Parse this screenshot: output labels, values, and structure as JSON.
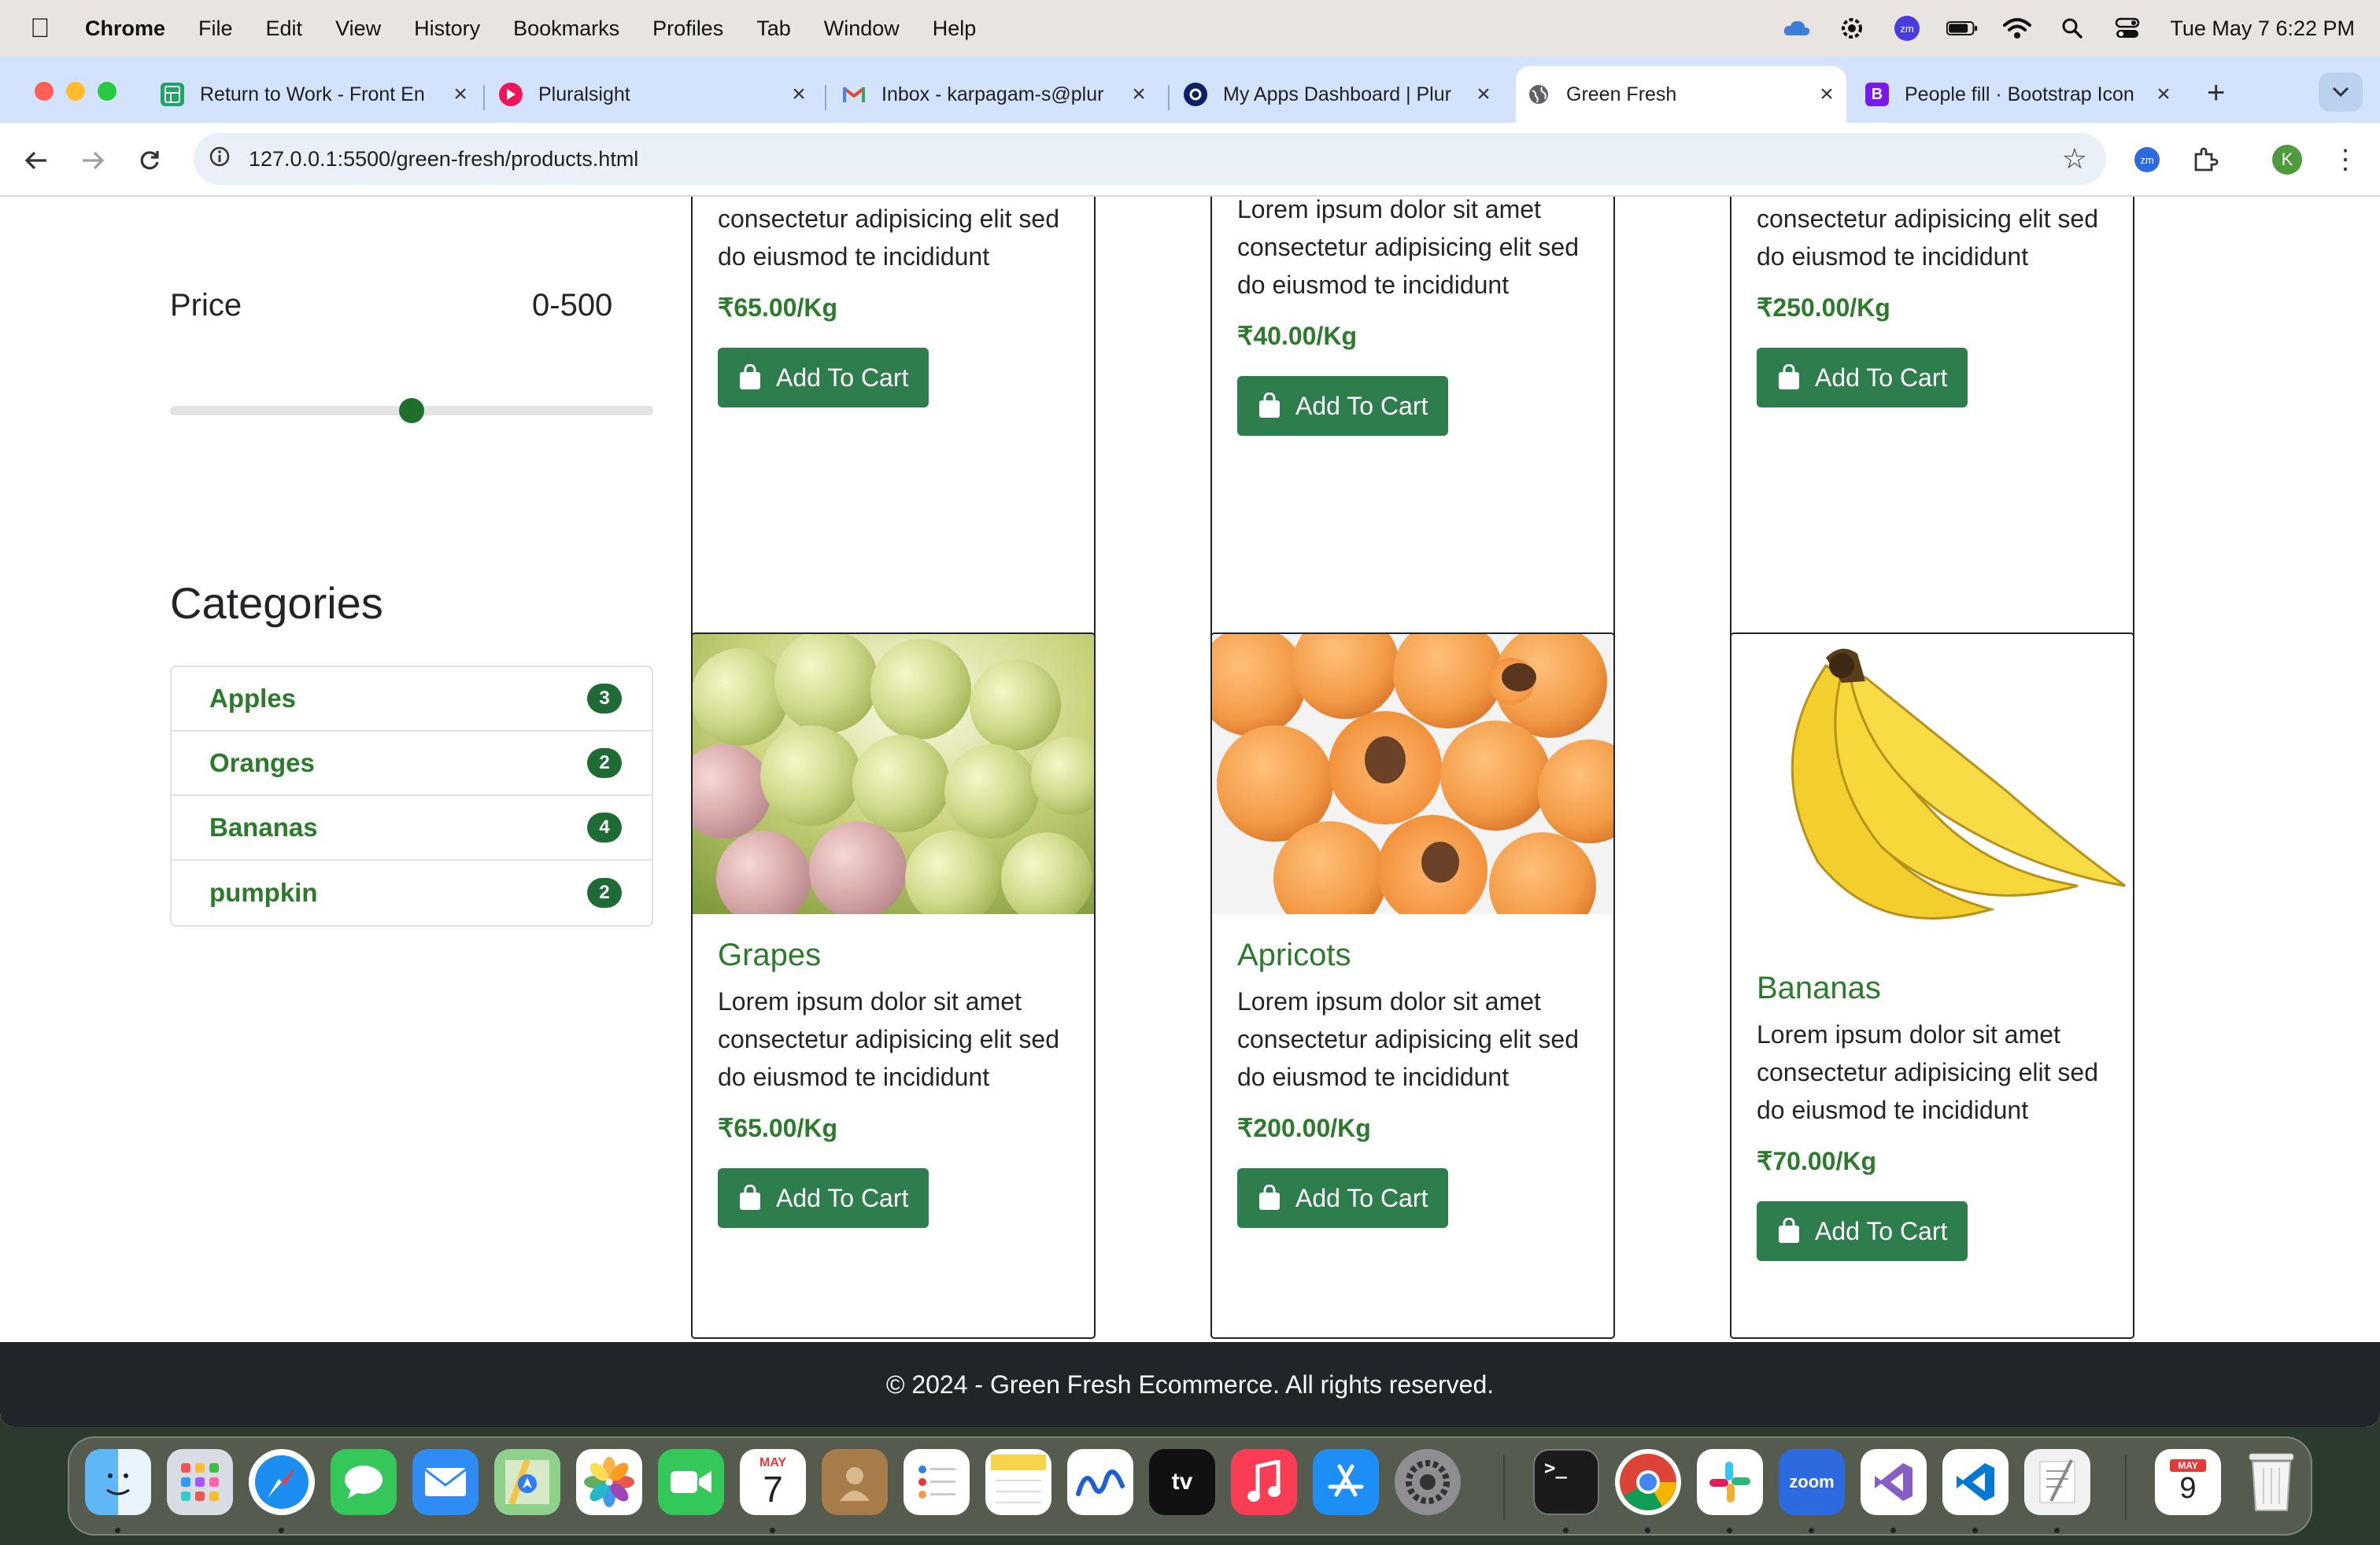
{
  "menubar": {
    "app": "Chrome",
    "items": [
      "File",
      "Edit",
      "View",
      "History",
      "Bookmarks",
      "Profiles",
      "Tab",
      "Window",
      "Help"
    ],
    "clock": "Tue May 7  6:22 PM"
  },
  "tabs": [
    {
      "title": "Return to Work - Front En",
      "icon": "sheets-icon"
    },
    {
      "title": "Pluralsight",
      "icon": "pluralsight-icon"
    },
    {
      "title": "Inbox - karpagam-s@plur",
      "icon": "gmail-icon"
    },
    {
      "title": "My Apps Dashboard | Plur",
      "icon": "okta-icon"
    },
    {
      "title": "Green Fresh",
      "icon": "globe-icon"
    },
    {
      "title": "People fill · Bootstrap Icon",
      "icon": "bootstrap-icon"
    }
  ],
  "toolbar": {
    "url": "127.0.0.1:5500/green-fresh/products.html",
    "profile_initial": "K"
  },
  "sidebar": {
    "price_label": "Price",
    "price_range": "0-500",
    "price_slider_value": 250,
    "price_slider_max": 500,
    "categories_title": "Categories",
    "categories": [
      {
        "name": "Apples",
        "count": "3"
      },
      {
        "name": "Oranges",
        "count": "2"
      },
      {
        "name": "Bananas",
        "count": "4"
      },
      {
        "name": "pumpkin",
        "count": "2"
      }
    ]
  },
  "products_top": [
    {
      "text": "consectetur adipisicing elit sed do eiusmod te incididunt",
      "price": "₹65.00/Kg",
      "button": "Add To Cart"
    },
    {
      "text": "Lorem ipsum dolor sit amet consectetur adipisicing elit sed do eiusmod te incididunt",
      "price": "₹40.00/Kg",
      "button": "Add To Cart"
    },
    {
      "text": "consectetur adipisicing elit sed do eiusmod te incididunt",
      "price": "₹250.00/Kg",
      "button": "Add To Cart"
    }
  ],
  "products": [
    {
      "name": "Grapes",
      "text": "Lorem ipsum dolor sit amet consectetur adipisicing elit sed do eiusmod te incididunt",
      "price": "₹65.00/Kg",
      "button": "Add To Cart"
    },
    {
      "name": "Apricots",
      "text": "Lorem ipsum dolor sit amet consectetur adipisicing elit sed do eiusmod te incididunt",
      "price": "₹200.00/Kg",
      "button": "Add To Cart"
    },
    {
      "name": "Bananas",
      "text": "Lorem ipsum dolor sit amet consectetur adipisicing elit sed do eiusmod te incididunt",
      "price": "₹70.00/Kg",
      "button": "Add To Cart"
    }
  ],
  "footer": {
    "text": "© 2024 - Green Fresh Ecommerce. All rights reserved."
  },
  "dock": {
    "calendar_month": "MAY",
    "calendar_day": "7",
    "calendar2_month": "MAY",
    "calendar2_day": "9",
    "zoom_label": "zoom",
    "apps": [
      "finder",
      "launchpad",
      "safari",
      "messages",
      "mail",
      "maps",
      "photos",
      "facetime",
      "calendar",
      "contacts",
      "reminders",
      "notes",
      "freeform",
      "tv",
      "music",
      "app-store",
      "system-settings",
      "terminal",
      "chrome",
      "slack",
      "zoom",
      "visual-studio",
      "vscode",
      "textedit",
      "calendar-2",
      "trash"
    ]
  },
  "colors": {
    "brand_green": "#2c7a2c",
    "button_green": "#2e7d4c",
    "footer_bg": "#212529",
    "tabstrip_bg": "#d3e3fd"
  }
}
